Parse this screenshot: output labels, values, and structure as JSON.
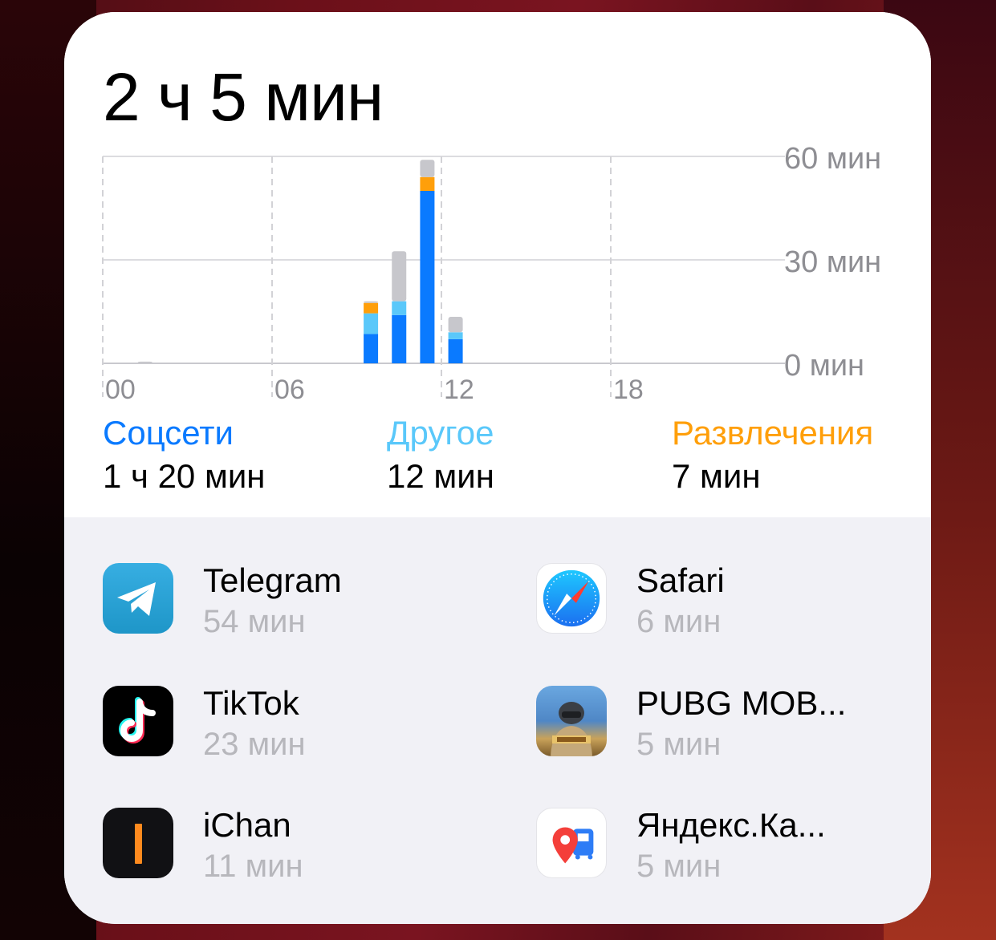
{
  "widget": {
    "total": "2 ч 5 мин"
  },
  "chart_data": {
    "type": "bar",
    "stacked": true,
    "x_tick_labels": [
      "00",
      "06",
      "12",
      "18"
    ],
    "y_tick_labels": [
      "60 мин",
      "30 мин",
      "0 мин"
    ],
    "ylim": [
      0,
      60
    ],
    "grid": true,
    "bars": [
      {
        "hour": 1,
        "Соцсети": 0,
        "Другое": 0,
        "Развлечения": 0,
        "Прочее": 0.5
      },
      {
        "hour": 9,
        "Соцсети": 8.5,
        "Другое": 6,
        "Развлечения": 3,
        "Прочее": 0.5
      },
      {
        "hour": 10,
        "Соцсети": 14,
        "Другое": 4,
        "Развлечения": 0,
        "Прочее": 14.5
      },
      {
        "hour": 11,
        "Соцсети": 50,
        "Другое": 0,
        "Развлечения": 4,
        "Прочее": 5
      },
      {
        "hour": 12,
        "Соцсети": 7,
        "Другое": 2,
        "Развлечения": 0,
        "Прочее": 4.5
      }
    ],
    "series_colors": {
      "Соцсети": "#0a7aff",
      "Другое": "#5ac8fa",
      "Развлечения": "#ff9f0a",
      "Прочее": "#c7c7cc"
    }
  },
  "legend": [
    {
      "label": "Соцсети",
      "value": "1 ч 20 мин",
      "color": "#0a7aff"
    },
    {
      "label": "Другое",
      "value": "12 мин",
      "color": "#5ac8fa"
    },
    {
      "label": "Развлечения",
      "value": "7 мин",
      "color": "#ff9f0a"
    }
  ],
  "apps": [
    {
      "name": "Telegram",
      "time": "54 мин",
      "icon": "telegram-icon"
    },
    {
      "name": "Safari",
      "time": "6 мин",
      "icon": "safari-icon"
    },
    {
      "name": "TikTok",
      "time": "23 мин",
      "icon": "tiktok-icon"
    },
    {
      "name": "PUBG MOB...",
      "time": "5 мин",
      "icon": "pubg-icon"
    },
    {
      "name": "iChan",
      "time": "11 мин",
      "icon": "ichan-icon"
    },
    {
      "name": "Яндекс.Ка...",
      "time": "5 мин",
      "icon": "yandex-maps-icon"
    }
  ]
}
